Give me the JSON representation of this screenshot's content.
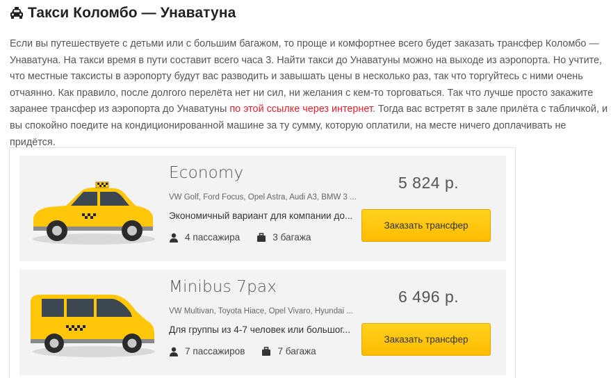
{
  "title": "Такси Коломбо — Унаватуна",
  "intro": {
    "before_link": "Если вы путешествуете с детьми или с большим багажом, то проще и комфортнее всего будет заказать трансфер Коломбо — Унаватуна. На такси время в пути составит всего часа 3. Найти такси до Унаватуны можно на выходе из аэропорта. Но учтите, что местные таксисты в аэропорту будут вас разводить и завышать цены в несколько раз, так что торгуйтесь с ними очень отчаянно. Как правило, после долгого перелёта нет ни сил, ни желания с кем-то торговаться. Так что лучше просто закажите заранее трансфер из аэропорта до Унаватуны ",
    "link": "по этой ссылке через интернет",
    "after_link": ". Тогда вас встретят в зале прилёта с табличкой, и вы спокойно поедите на кондиционированной машине за ту сумму, которую оплатили, на месте ничего доплачивать не придётся."
  },
  "colors": {
    "accent": "#ffc60a",
    "link": "#e8212d",
    "card_bg": "#f3f3f3"
  },
  "cards": [
    {
      "class": "Economy",
      "models": "VW Golf, Ford Focus, Opel Astra, Audi A3, BMW 3 ...",
      "description": "Экономичный вариант для компании до...",
      "passengers": "4 пассажира",
      "luggage": "3 багажа",
      "price": "5 824 р.",
      "button": "Заказать трансфер"
    },
    {
      "class": "Minibus 7pax",
      "models": "VW Multivan, Toyota Hiace, Opel Vivaro, Hyundai ...",
      "description": "Для группы из 4-7 человек или большог...",
      "passengers": "7 пассажиров",
      "luggage": "7 багажа",
      "price": "6 496 р.",
      "button": "Заказать трансфер"
    }
  ]
}
